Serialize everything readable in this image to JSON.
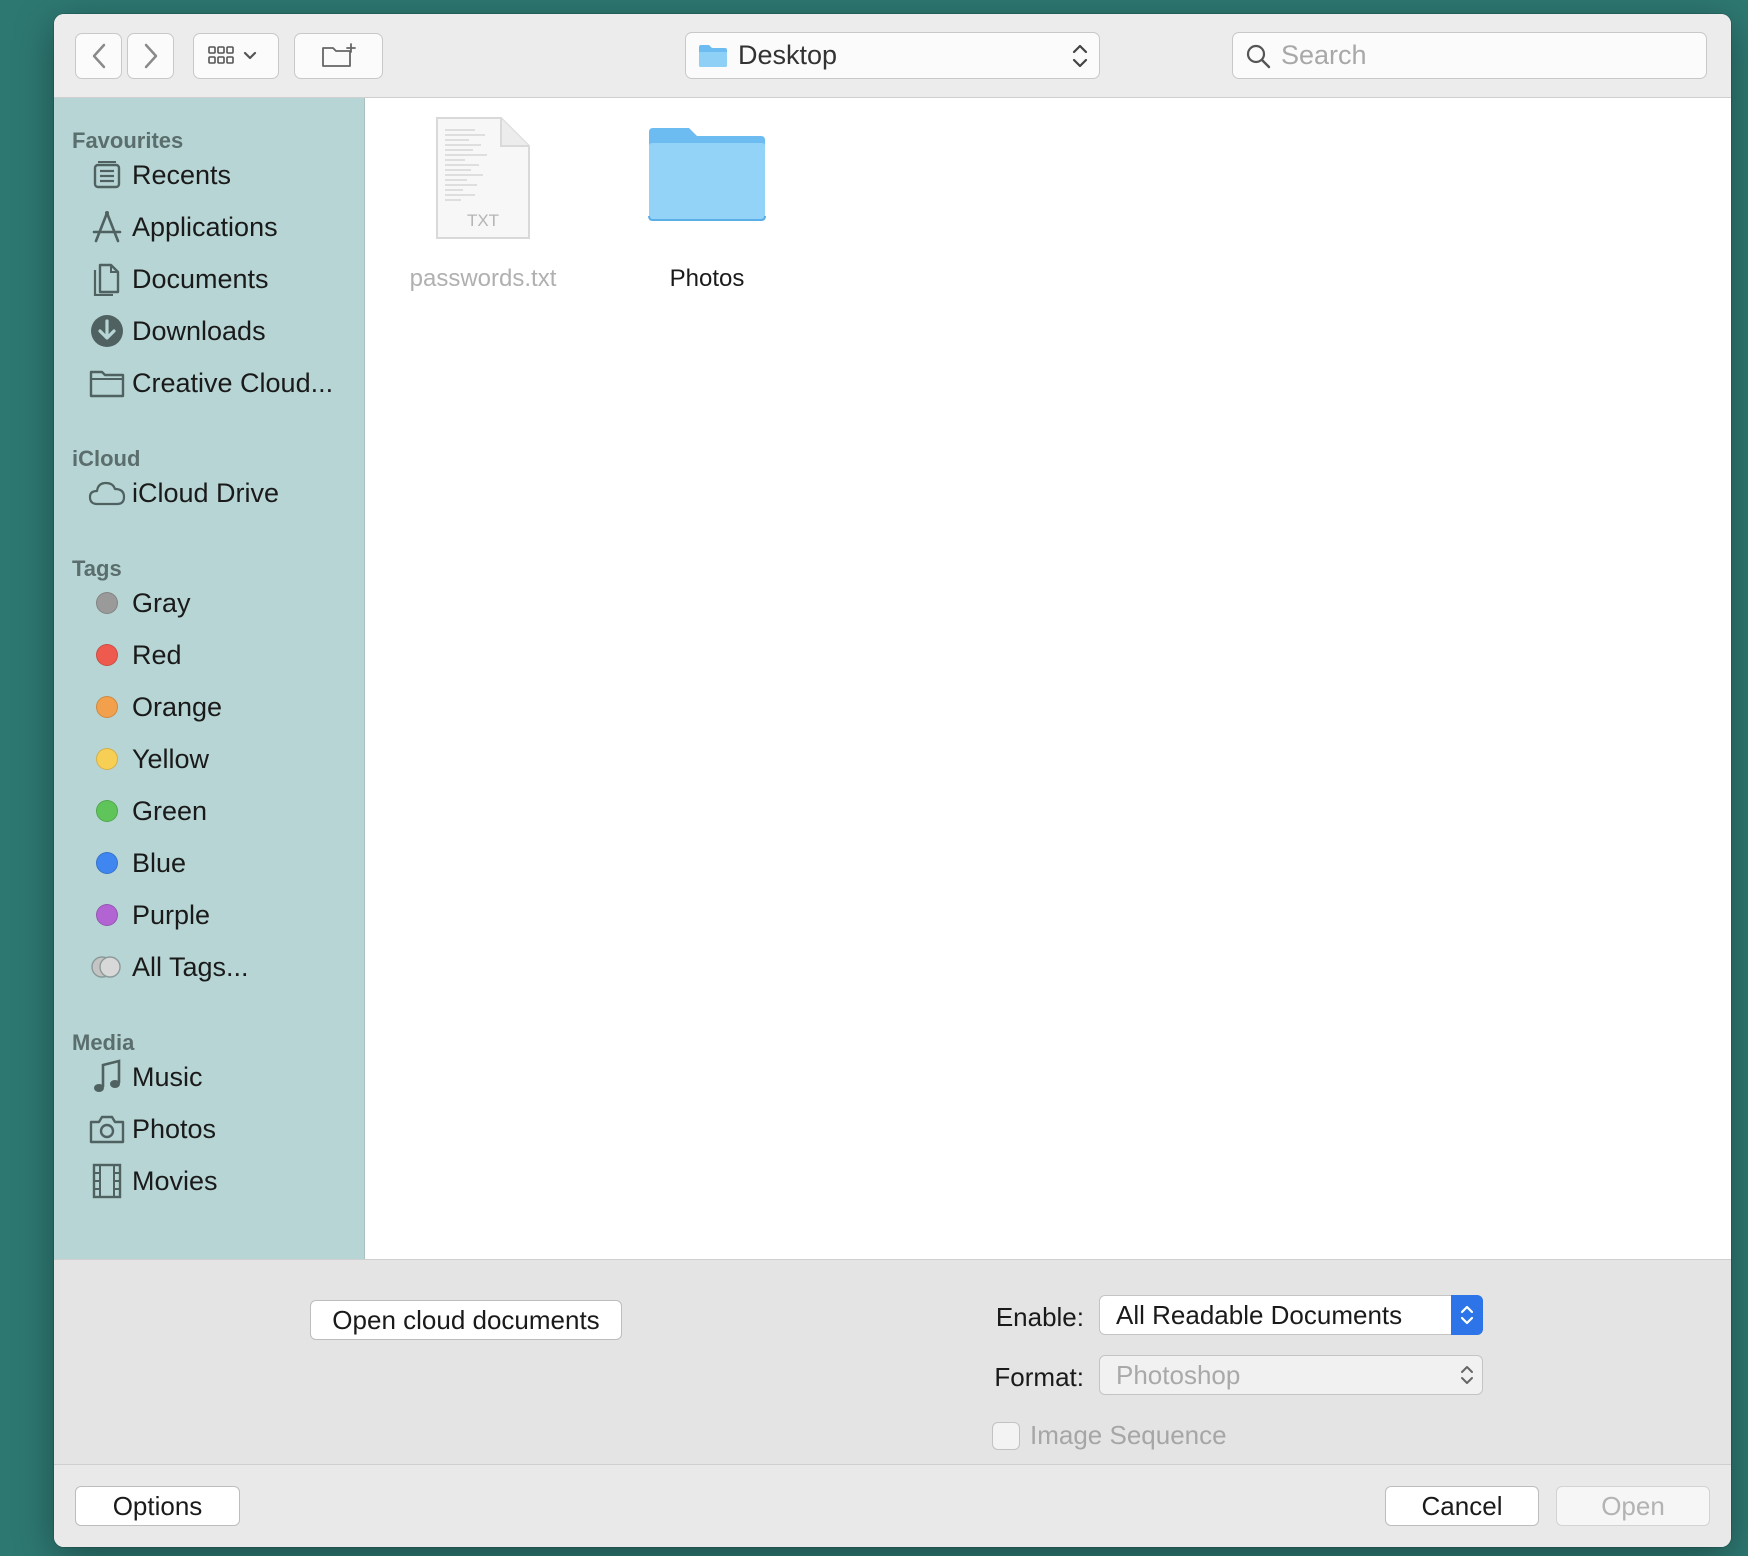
{
  "toolbar": {
    "back_label": "Back",
    "forward_label": "Forward",
    "location": "Desktop",
    "search_placeholder": "Search"
  },
  "sidebar": {
    "favourites_header": "Favourites",
    "favourites": [
      {
        "label": "Recents",
        "icon": "recents-icon"
      },
      {
        "label": "Applications",
        "icon": "applications-icon"
      },
      {
        "label": "Documents",
        "icon": "documents-icon"
      },
      {
        "label": "Downloads",
        "icon": "downloads-icon"
      },
      {
        "label": "Creative Cloud...",
        "icon": "folder-icon"
      }
    ],
    "icloud_header": "iCloud",
    "icloud": [
      {
        "label": "iCloud Drive",
        "icon": "cloud-icon"
      }
    ],
    "tags_header": "Tags",
    "tags": [
      {
        "label": "Gray",
        "color": "#9a9a9a"
      },
      {
        "label": "Red",
        "color": "#ee5a4e"
      },
      {
        "label": "Orange",
        "color": "#f2a04c"
      },
      {
        "label": "Yellow",
        "color": "#f8cf55"
      },
      {
        "label": "Green",
        "color": "#5fc55b"
      },
      {
        "label": "Blue",
        "color": "#3f86f0"
      },
      {
        "label": "Purple",
        "color": "#b264d2"
      },
      {
        "label": "All Tags...",
        "color": "#c4c4c4"
      }
    ],
    "media_header": "Media",
    "media": [
      {
        "label": "Music",
        "icon": "music-note-icon"
      },
      {
        "label": "Photos",
        "icon": "camera-icon"
      },
      {
        "label": "Movies",
        "icon": "film-icon"
      }
    ]
  },
  "files": [
    {
      "name": "passwords.txt",
      "type_badge": "TXT",
      "enabled": false
    },
    {
      "name": "Photos",
      "type_badge": "",
      "enabled": true
    }
  ],
  "accessory": {
    "open_cloud_label": "Open cloud documents",
    "enable_label": "Enable:",
    "enable_value": "All Readable Documents",
    "format_label": "Format:",
    "format_value": "Photoshop",
    "image_sequence_label": "Image Sequence",
    "image_sequence_checked": false
  },
  "bottom": {
    "options_label": "Options",
    "cancel_label": "Cancel",
    "open_label": "Open"
  }
}
